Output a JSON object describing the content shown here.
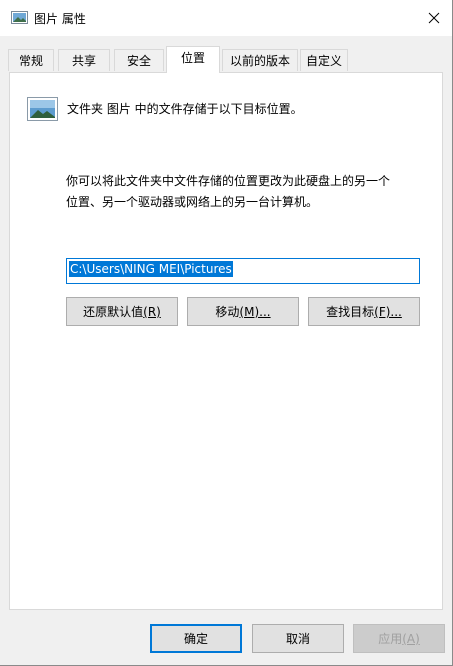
{
  "window": {
    "title": "图片 属性"
  },
  "tabs": [
    {
      "label": "常规"
    },
    {
      "label": "共享"
    },
    {
      "label": "安全"
    },
    {
      "label": "位置",
      "active": true
    },
    {
      "label": "以前的版本"
    },
    {
      "label": "自定义"
    }
  ],
  "location": {
    "description": "文件夹 图片 中的文件存储于以下目标位置。",
    "info_line1": "你可以将此文件夹中文件存储的位置更改为此硬盘上的另一个",
    "info_line2": "位置、另一个驱动器或网络上的另一台计算机。",
    "path_value": "C:\\Users\\NING MEI\\Pictures",
    "restore_label": "还原默认值",
    "restore_key": "(R)",
    "move_label": "移动",
    "move_key": "(M)...",
    "find_label": "查找目标",
    "find_key": "(F)..."
  },
  "footer": {
    "ok_label": "确定",
    "cancel_label": "取消",
    "apply_label": "应用",
    "apply_key": "(A)"
  },
  "icons": {
    "title": "folder-pictures-icon",
    "close": "close-icon",
    "folder": "folder-pictures-icon"
  },
  "colors": {
    "accent": "#0078d7",
    "window_bg": "#f0f0f0",
    "button_bg": "#e1e1e1"
  }
}
